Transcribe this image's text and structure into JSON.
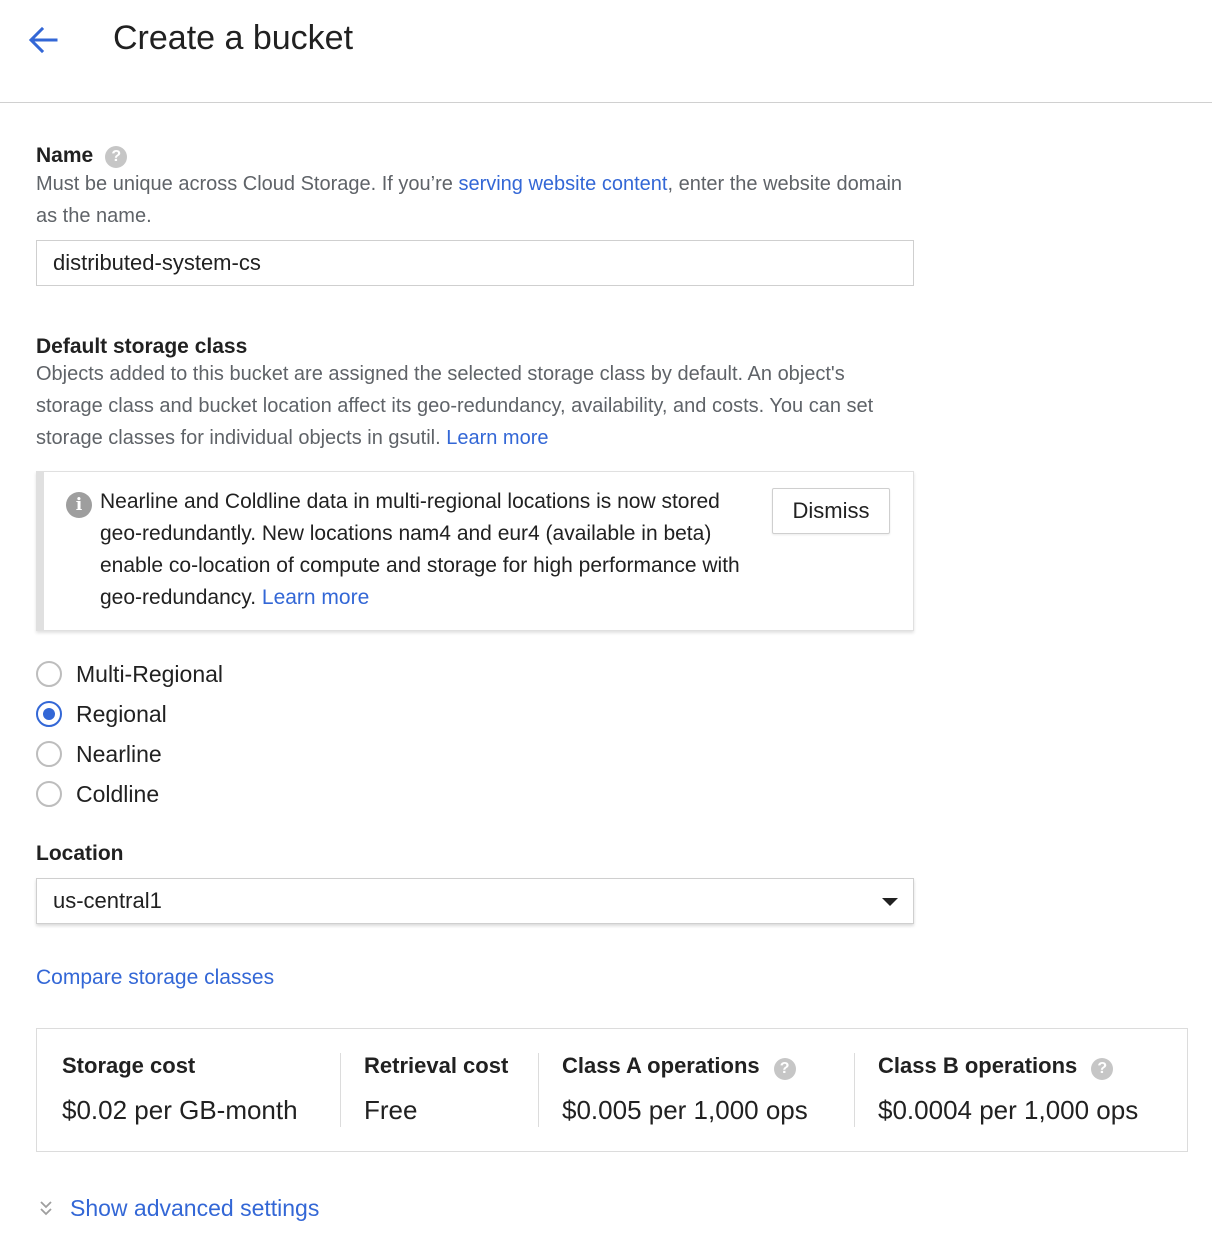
{
  "header": {
    "title": "Create a bucket",
    "back_icon": "arrow-left-icon"
  },
  "name_section": {
    "label": "Name",
    "help_glyph": "?",
    "description_before": "Must be unique across Cloud Storage. If you’re ",
    "link_text": "serving website content",
    "description_after": ", enter the website domain as the name.",
    "input_value": "distributed-system-cs"
  },
  "storage_class": {
    "label": "Default storage class",
    "description": "Objects added to this bucket are assigned the selected storage class by default. An object's storage class and bucket location affect its geo-redundancy, availability, and costs. You can set storage classes for individual objects in gsutil. ",
    "learn_more": "Learn more",
    "info": {
      "icon_glyph": "i",
      "text": "Nearline and Coldline data in multi-regional locations is now stored geo-redundantly. New locations nam4 and eur4 (available in beta) enable co-location of compute and storage for high performance with geo-redundancy. ",
      "learn_more": "Learn more",
      "dismiss_label": "Dismiss"
    },
    "options": [
      {
        "label": "Multi-Regional",
        "checked": false
      },
      {
        "label": "Regional",
        "checked": true
      },
      {
        "label": "Nearline",
        "checked": false
      },
      {
        "label": "Coldline",
        "checked": false
      }
    ]
  },
  "location": {
    "label": "Location",
    "selected": "us-central1"
  },
  "compare_link": "Compare storage classes",
  "costs": [
    {
      "title": "Storage cost",
      "value": "$0.02 per GB-month"
    },
    {
      "title": "Retrieval cost",
      "value": "Free"
    },
    {
      "title": "Class A operations",
      "value": "$0.005 per 1,000 ops"
    },
    {
      "title": "Class B operations",
      "value": "$0.0004 per 1,000 ops"
    }
  ],
  "advanced_label": "Show advanced settings",
  "colors": {
    "accent": "#3367d6",
    "text": "#212121",
    "secondary_text": "#5f6368",
    "border": "#cfcfcf"
  }
}
